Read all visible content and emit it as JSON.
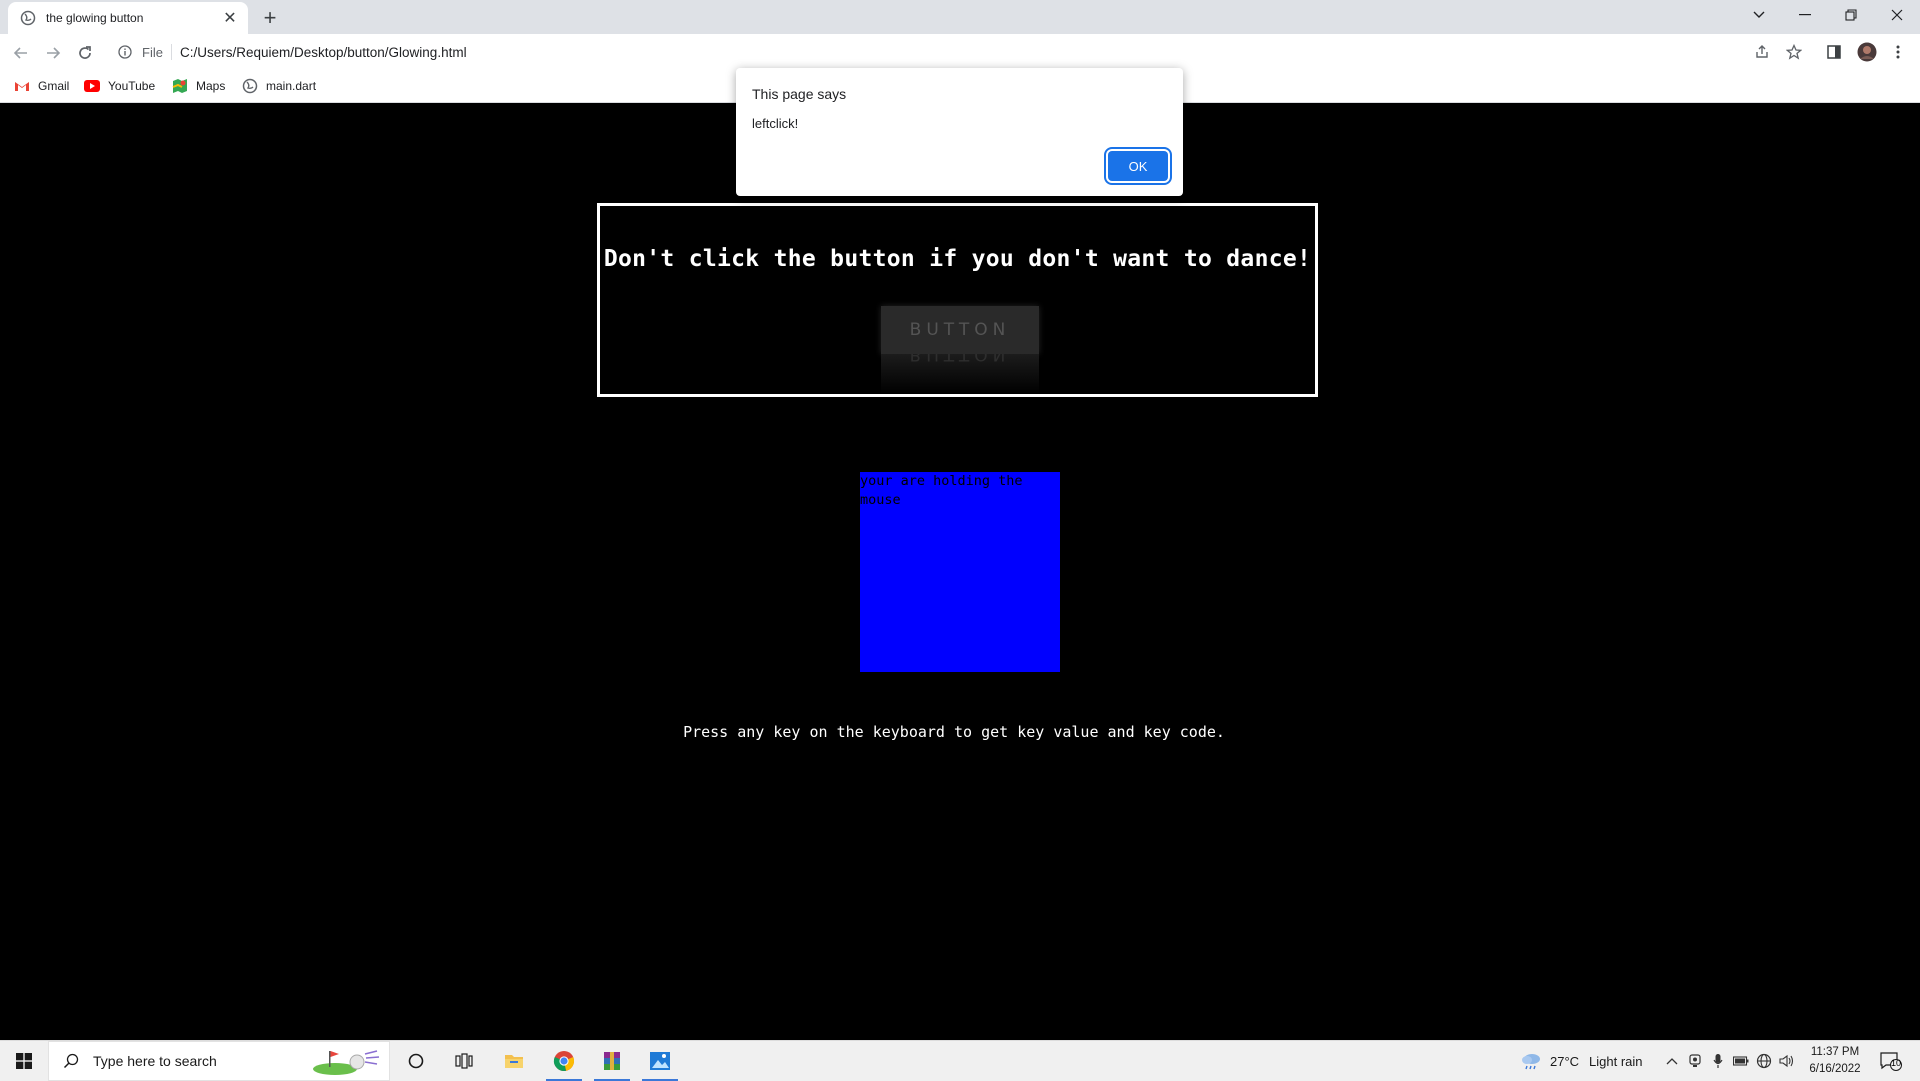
{
  "browser": {
    "tab": {
      "title": "the glowing button"
    },
    "toolbar": {
      "scheme": "File",
      "url": "C:/Users/Requiem/Desktop/button/Glowing.html"
    },
    "bookmarks": [
      {
        "label": "Gmail"
      },
      {
        "label": "YouTube"
      },
      {
        "label": "Maps"
      },
      {
        "label": "main.dart"
      }
    ]
  },
  "page": {
    "title": "Don't click the button if you don't want to dance!",
    "button_label": "BUTTON",
    "blue_box_text": "your are holding the mouse",
    "key_hint": "Press any key on the keyboard to get key value and key code."
  },
  "alert": {
    "heading": "This page says",
    "message": "leftclick!",
    "ok_label": "OK"
  },
  "taskbar": {
    "search_placeholder": "Type here to search",
    "weather_temp": "27°C",
    "weather_desc": "Light rain",
    "time": "11:37 PM",
    "date": "6/16/2022",
    "notification_count": "10"
  },
  "colors": {
    "page_bg": "#000000",
    "blue_box": "#0000ff",
    "ok_button": "#1a73e8"
  }
}
